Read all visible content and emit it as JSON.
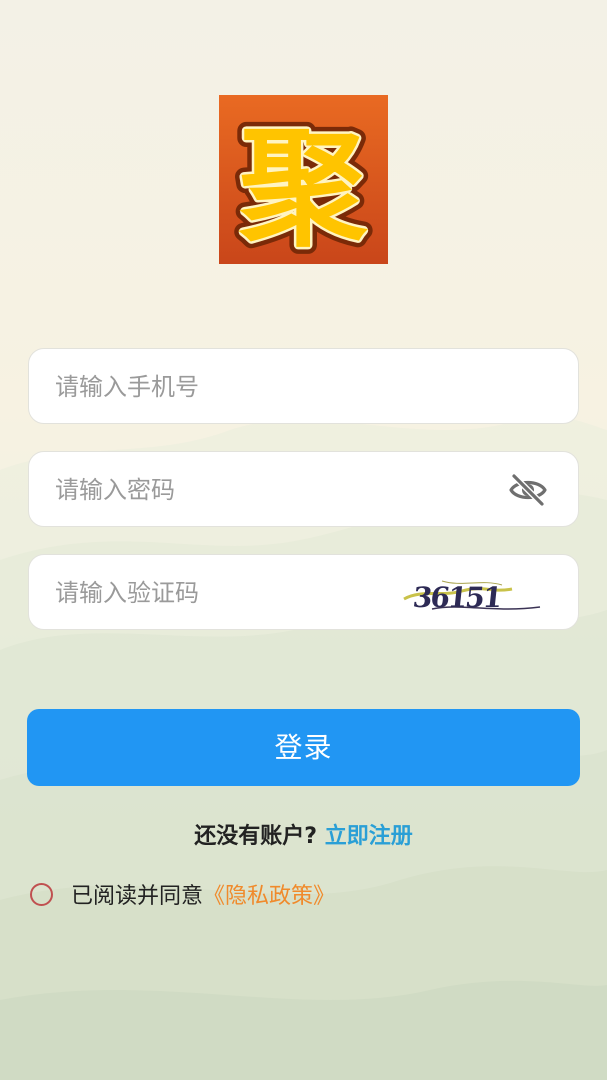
{
  "logo": {
    "character": "聚",
    "icon": "app-logo",
    "background_color": "#d9541c",
    "text_color": "#ffd21a"
  },
  "form": {
    "phone_placeholder": "请输入手机号",
    "password_placeholder": "请输入密码",
    "captcha_placeholder": "请输入验证码",
    "captcha_text": "36151",
    "password_toggle_icon": "eye-off-icon"
  },
  "login_button": {
    "label": "登录",
    "color": "#2196f3"
  },
  "register": {
    "prompt": "还没有账户?",
    "link": "立即注册",
    "link_color": "#2a9fd6"
  },
  "agreement": {
    "text": "已阅读并同意",
    "policy_link": "《隐私政策》",
    "policy_color": "#f08a2b",
    "checked": false
  }
}
